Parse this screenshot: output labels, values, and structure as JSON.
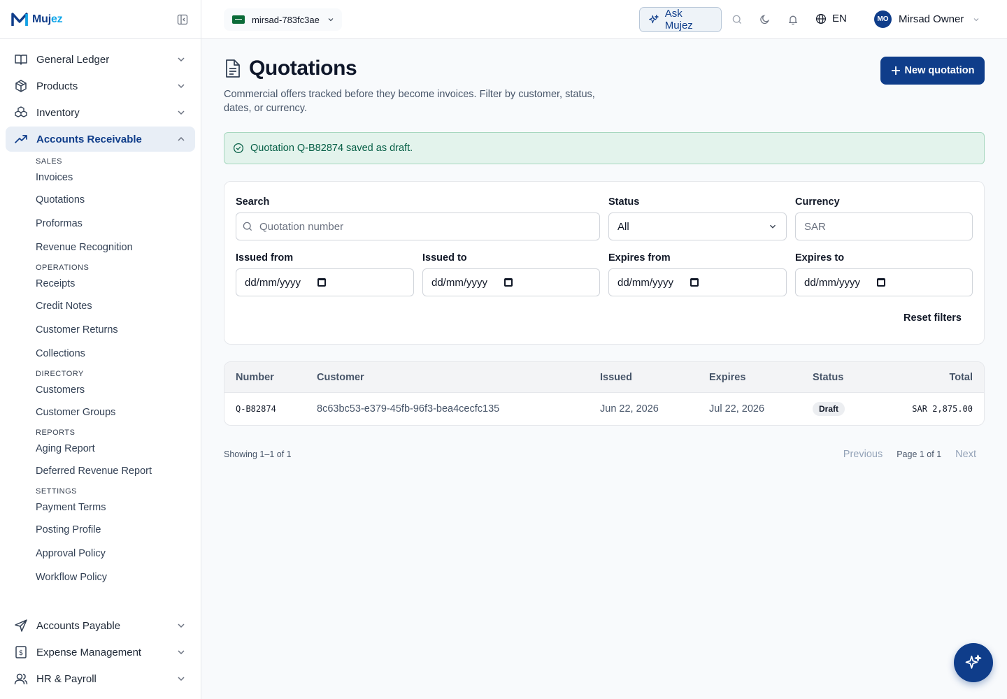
{
  "brand": {
    "name_a": "Muj",
    "name_b": "ez"
  },
  "sidebar": {
    "top_items": [
      {
        "label": "General Ledger",
        "icon": "book-open-icon"
      },
      {
        "label": "Products",
        "icon": "box-icon"
      },
      {
        "label": "Inventory",
        "icon": "boxes-icon"
      },
      {
        "label": "Accounts Receivable",
        "icon": "trending-up-icon"
      }
    ],
    "groups": [
      {
        "heading": "SALES",
        "items": [
          "Invoices",
          "Quotations",
          "Proformas",
          "Revenue Recognition"
        ]
      },
      {
        "heading": "OPERATIONS",
        "items": [
          "Receipts",
          "Credit Notes",
          "Customer Returns",
          "Collections"
        ]
      },
      {
        "heading": "DIRECTORY",
        "items": [
          "Customers",
          "Customer Groups"
        ]
      },
      {
        "heading": "REPORTS",
        "items": [
          "Aging Report",
          "Deferred Revenue Report"
        ]
      },
      {
        "heading": "SETTINGS",
        "items": [
          "Payment Terms",
          "Posting Profile",
          "Approval Policy",
          "Workflow Policy"
        ]
      }
    ],
    "bottom_items": [
      {
        "label": "Accounts Payable",
        "icon": "send-icon"
      },
      {
        "label": "Expense Management",
        "icon": "receipt-icon"
      },
      {
        "label": "HR & Payroll",
        "icon": "users-icon"
      }
    ]
  },
  "topbar": {
    "org": "mirsad-783fc3ae",
    "ask": "Ask Mujez",
    "lang": "EN",
    "user_initials": "MO",
    "user_name": "Mirsad Owner"
  },
  "page": {
    "title": "Quotations",
    "description": "Commercial offers tracked before they become invoices. Filter by customer, status, dates, or currency.",
    "new_button": "New quotation",
    "alert": "Quotation Q-B82874 saved as draft."
  },
  "filters": {
    "search_label": "Search",
    "search_placeholder": "Quotation number",
    "status_label": "Status",
    "status_value": "All",
    "currency_label": "Currency",
    "currency_placeholder": "SAR",
    "issued_from_label": "Issued from",
    "issued_to_label": "Issued to",
    "expires_from_label": "Expires from",
    "expires_to_label": "Expires to",
    "date_placeholder": "dd/mm/yyyy",
    "reset": "Reset filters"
  },
  "table": {
    "headers": {
      "number": "Number",
      "customer": "Customer",
      "issued": "Issued",
      "expires": "Expires",
      "status": "Status",
      "total": "Total"
    },
    "rows": [
      {
        "number": "Q-B82874",
        "customer": "8c63bc53-e379-45fb-96f3-bea4cecfc135",
        "issued": "Jun 22, 2026",
        "expires": "Jul 22, 2026",
        "status": "Draft",
        "total": "SAR 2,875.00"
      }
    ]
  },
  "pager": {
    "showing": "Showing 1–1 of 1",
    "previous": "Previous",
    "page": "Page 1 of 1",
    "next": "Next"
  }
}
